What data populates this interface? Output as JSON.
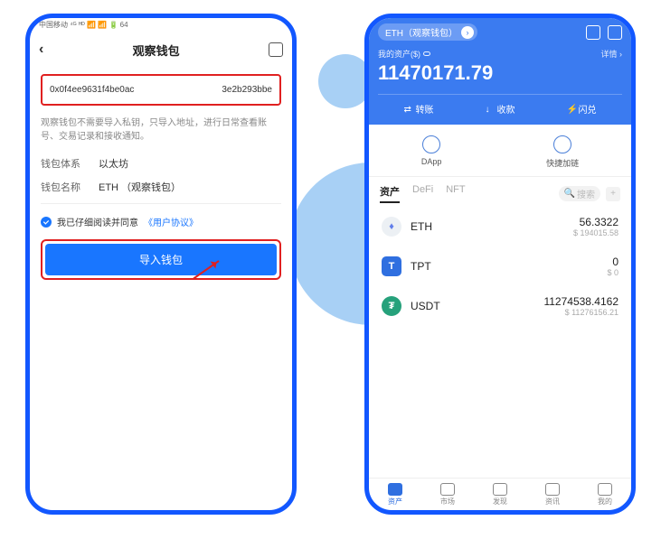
{
  "left": {
    "status": "中国移动 ⁴ᴳ ᴴᴰ 📶 📶 🔋 64",
    "title": "观察钱包",
    "addr_left": "0x0f4ee9631f4be0ac",
    "addr_right": "3e2b293bbe",
    "desc": "观察钱包不需要导入私钥，只导入地址，进行日常查看账号、交易记录和接收通知。",
    "chain_label": "钱包体系",
    "chain_value": "以太坊",
    "name_label": "钱包名称",
    "name_value": "ETH （观察钱包）",
    "agree_text": "我已仔细阅读并同意",
    "agreement_link": "《用户协议》",
    "import_btn": "导入钱包"
  },
  "right": {
    "pill_label": "ETH（观察钱包）",
    "card_label": "我的资产($)",
    "detail": "详情 ›",
    "amount": "11470171.79",
    "actions": {
      "transfer": "转账",
      "receive": "收款",
      "swap": "闪兑"
    },
    "mid": {
      "dapp": "DApp",
      "quick": "快捷加链"
    },
    "tabs": {
      "assets": "资产",
      "defi": "DeFi",
      "nft": "NFT"
    },
    "search_placeholder": "搜索",
    "assets": [
      {
        "sym": "ETH",
        "amt": "56.3322",
        "fiat": "$ 194015.58"
      },
      {
        "sym": "TPT",
        "amt": "0",
        "fiat": "$ 0"
      },
      {
        "sym": "USDT",
        "amt": "11274538.4162",
        "fiat": "$ 11276156.21"
      }
    ],
    "bottom": {
      "assets": "资产",
      "market": "市场",
      "discover": "发现",
      "news": "资讯",
      "me": "我的"
    }
  }
}
